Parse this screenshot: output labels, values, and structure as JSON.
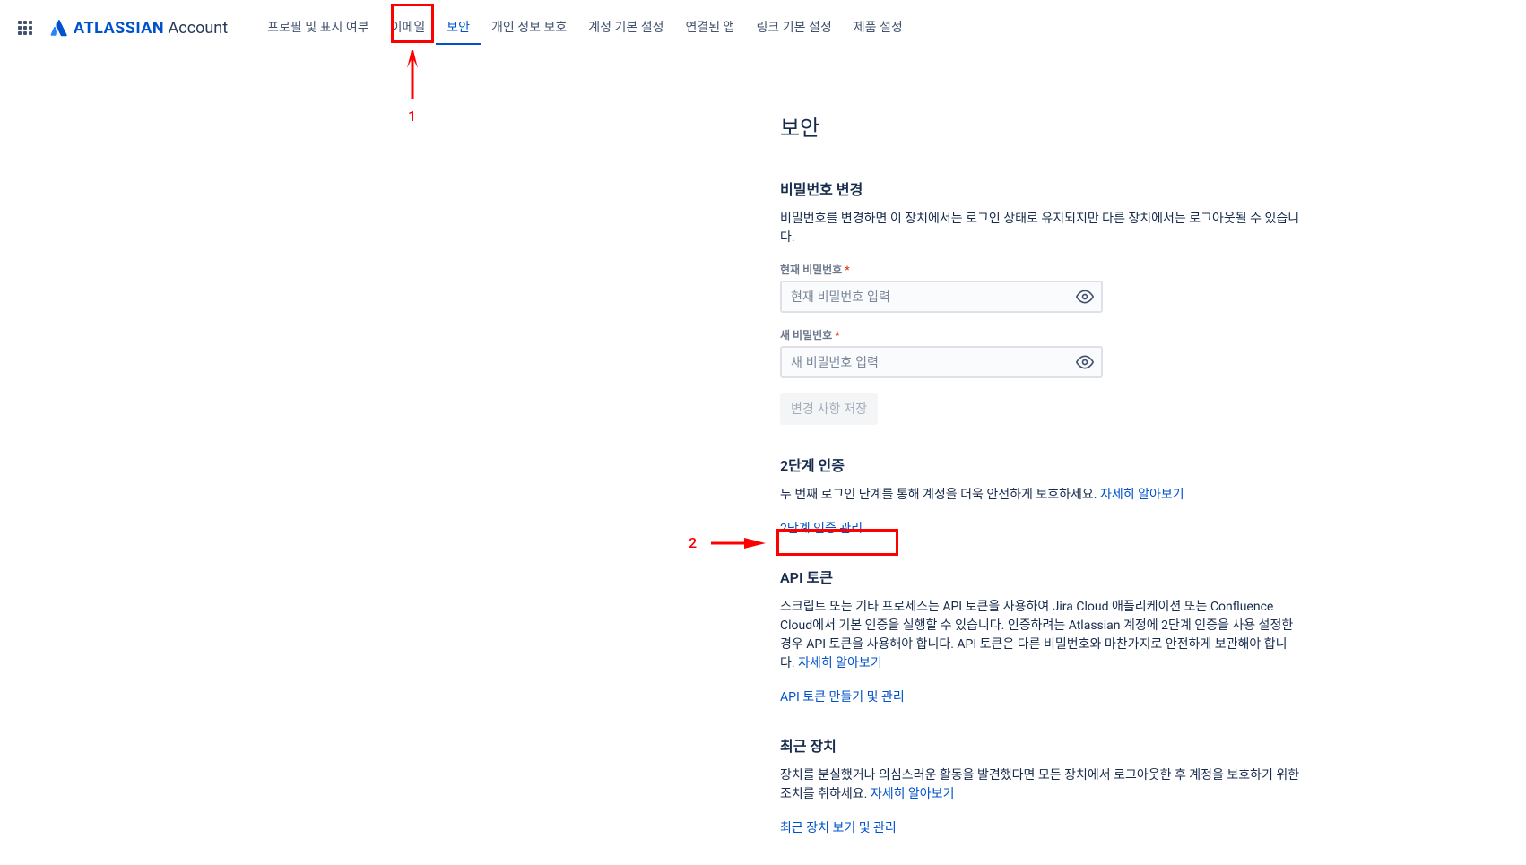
{
  "header": {
    "logo_brand": "ATLASSIAN",
    "logo_product": "Account"
  },
  "nav": {
    "items": [
      {
        "label": "프로필 및 표시 여부"
      },
      {
        "label": "이메일"
      },
      {
        "label": "보안",
        "active": true
      },
      {
        "label": "개인 정보 보호"
      },
      {
        "label": "계정 기본 설정"
      },
      {
        "label": "연결된 앱"
      },
      {
        "label": "링크 기본 설정"
      },
      {
        "label": "제품 설정"
      }
    ]
  },
  "page": {
    "title": "보안"
  },
  "password_section": {
    "heading": "비밀번호 변경",
    "description": "비밀번호를 변경하면 이 장치에서는 로그인 상태로 유지되지만 다른 장치에서는 로그아웃될 수 있습니다.",
    "current_label": "현재 비밀번호",
    "current_placeholder": "현재 비밀번호 입력",
    "new_label": "새 비밀번호",
    "new_placeholder": "새 비밀번호 입력",
    "save_button": "변경 사항 저장"
  },
  "twostep_section": {
    "heading": "2단계 인증",
    "description": "두 번째 로그인 단계를 통해 계정을 더욱 안전하게 보호하세요.",
    "learn_more": "자세히 알아보기",
    "manage_link": "2단계 인증 관리"
  },
  "api_section": {
    "heading": "API 토큰",
    "description": "스크립트 또는 기타 프로세스는 API 토큰을 사용하여 Jira Cloud 애플리케이션 또는 Confluence Cloud에서 기본 인증을 실행할 수 있습니다. 인증하려는 Atlassian 계정에 2단계 인증을 사용 설정한 경우 API 토큰을 사용해야 합니다. API 토큰은 다른 비밀번호와 마찬가지로 안전하게 보관해야 합니다.",
    "learn_more": "자세히 알아보기",
    "manage_link": "API 토큰 만들기 및 관리"
  },
  "devices_section": {
    "heading": "최근 장치",
    "description": "장치를 분실했거나 의심스러운 활동을 발견했다면 모든 장치에서 로그아웃한 후 계정을 보호하기 위한 조치를 취하세요.",
    "learn_more": "자세히 알아보기",
    "manage_link": "최근 장치 보기 및 관리"
  },
  "annotations": {
    "label1": "1",
    "label2": "2"
  }
}
